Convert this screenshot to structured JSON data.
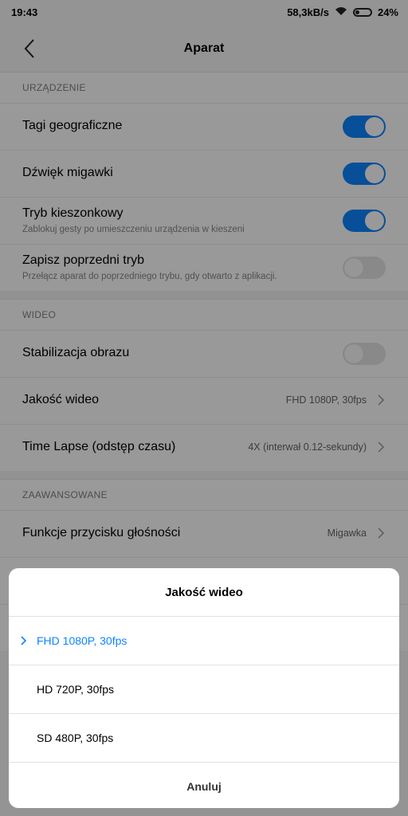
{
  "status_bar": {
    "time": "19:43",
    "speed": "58,3kB/s",
    "battery": "24%"
  },
  "header": {
    "title": "Aparat"
  },
  "sections": {
    "device": {
      "title": "URZĄDZENIE",
      "geotags": {
        "label": "Tagi geograficzne",
        "on": true
      },
      "shutter": {
        "label": "Dźwięk migawki",
        "on": true
      },
      "pocket": {
        "label": "Tryb kieszonkowy",
        "sub": "Zablokuj gesty po umieszczeniu urządzenia w kieszeni",
        "on": true
      },
      "prev_mode": {
        "label": "Zapisz poprzedni tryb",
        "sub": "Przełącz aparat do poprzedniego trybu, gdy otwarto z aplikacji.",
        "on": false
      }
    },
    "video": {
      "title": "WIDEO",
      "stabilization": {
        "label": "Stabilizacja obrazu",
        "on": false
      },
      "quality": {
        "label": "Jakość wideo",
        "value": "FHD 1080P, 30fps"
      },
      "timelapse": {
        "label": "Time Lapse (odstęp czasu)",
        "value": "4X (interwał 0.12-sekundy)"
      }
    },
    "advanced": {
      "title": "ZAAWANSOWANE",
      "volume": {
        "label": "Funkcje przycisku głośności",
        "value": "Migawka"
      }
    }
  },
  "dialog": {
    "title": "Jakość wideo",
    "options": [
      "FHD 1080P, 30fps",
      "HD 720P, 30fps",
      "SD 480P, 30fps"
    ],
    "selected_index": 0,
    "cancel": "Anuluj"
  },
  "colors": {
    "accent": "#0d84ff"
  }
}
